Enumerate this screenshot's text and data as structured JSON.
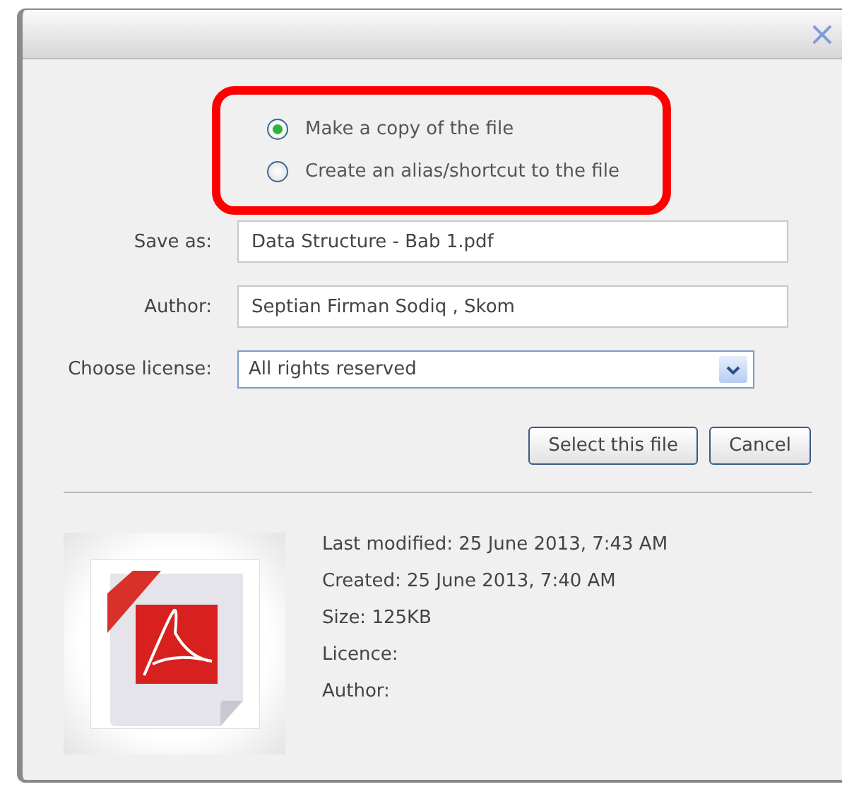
{
  "dialog": {
    "close": "×"
  },
  "options": [
    {
      "label": "Make a copy of the file",
      "selected": true
    },
    {
      "label": "Create an alias/shortcut to the file",
      "selected": false
    }
  ],
  "fields": [
    {
      "kind": "text",
      "label": "Save as:",
      "value": "Data Structure - Bab 1.pdf"
    },
    {
      "kind": "text",
      "label": "Author:",
      "value": "Septian Firman Sodiq , Skom"
    },
    {
      "kind": "select",
      "label": "Choose license:",
      "value": "All rights reserved"
    }
  ],
  "buttons": [
    "Select this file",
    "Cancel"
  ],
  "info": [
    "Last modified: 25 June 2013, 7:43 AM",
    "Created: 25 June 2013, 7:40 AM",
    "Size: 125KB",
    "Licence:",
    "Author:"
  ]
}
